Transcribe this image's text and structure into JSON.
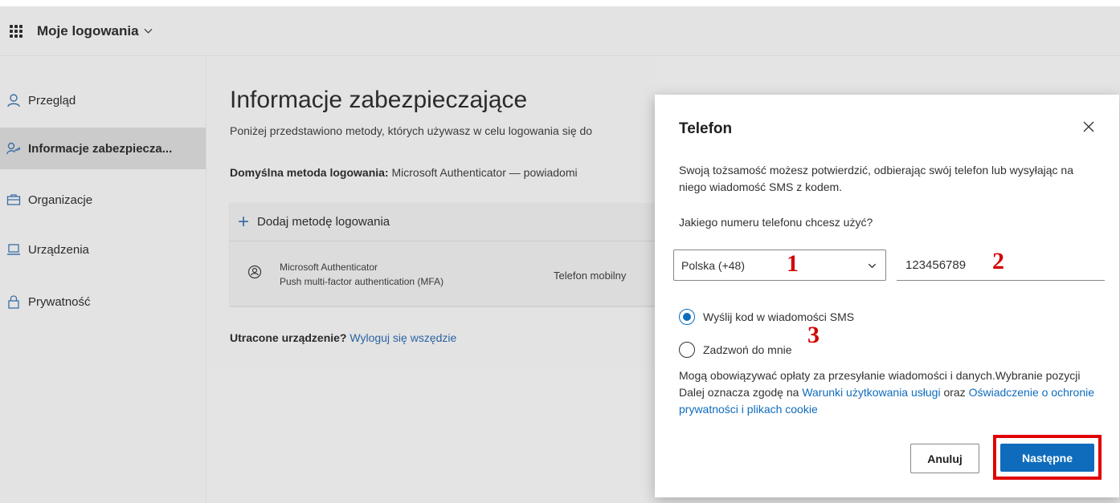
{
  "header": {
    "app_title": "Moje logowania"
  },
  "sidebar": {
    "items": [
      {
        "label": "Przegląd",
        "icon": "person-icon"
      },
      {
        "label": "Informacje zabezpiecza...",
        "icon": "security-info-icon",
        "active": true
      },
      {
        "label": "Organizacje",
        "icon": "organization-icon"
      },
      {
        "label": "Urządzenia",
        "icon": "laptop-icon"
      },
      {
        "label": "Prywatność",
        "icon": "lock-icon"
      }
    ]
  },
  "main": {
    "title": "Informacje zabezpieczające",
    "description": "Poniżej przedstawiono metody, których używasz w celu logowania się do",
    "default_method_label": "Domyślna metoda logowania:",
    "default_method_value": " Microsoft Authenticator — powiadomi",
    "add_method": "Dodaj metodę logowania",
    "methods": [
      {
        "name": "Microsoft Authenticator",
        "description": "Push multi-factor authentication (MFA)",
        "type": "Telefon mobilny"
      }
    ],
    "lost_device_label": "Utracone urządzenie?",
    "lost_device_link": "Wyloguj się wszędzie"
  },
  "dialog": {
    "title": "Telefon",
    "intro": "Swoją tożsamość możesz potwierdzić, odbierając swój telefon lub wysyłając na niego wiadomość SMS z kodem.",
    "question": "Jakiego numeru telefonu chcesz użyć?",
    "country_value": "Polska (+48)",
    "phone_value": "123456789",
    "radio_sms": "Wyślij kod w wiadomości SMS",
    "radio_call": "Zadzwoń do mnie",
    "selected_option": "sms",
    "legal_text_1": "Mogą obowiązywać opłaty za przesyłanie wiadomości i danych.Wybranie pozycji Dalej oznacza zgodę na ",
    "legal_link_terms": "Warunki użytkowania usługi",
    "legal_text_2": " oraz ",
    "legal_link_privacy": "Oświadczenie o ochronie prywatności i plikach cookie",
    "cancel_label": "Anuluj",
    "next_label": "Następne"
  },
  "annotations": {
    "a1": "1",
    "a2": "2",
    "a3": "3"
  },
  "colors": {
    "accent": "#0f6cbd",
    "annotation": "#d40000",
    "highlight_border": "#e00000"
  }
}
